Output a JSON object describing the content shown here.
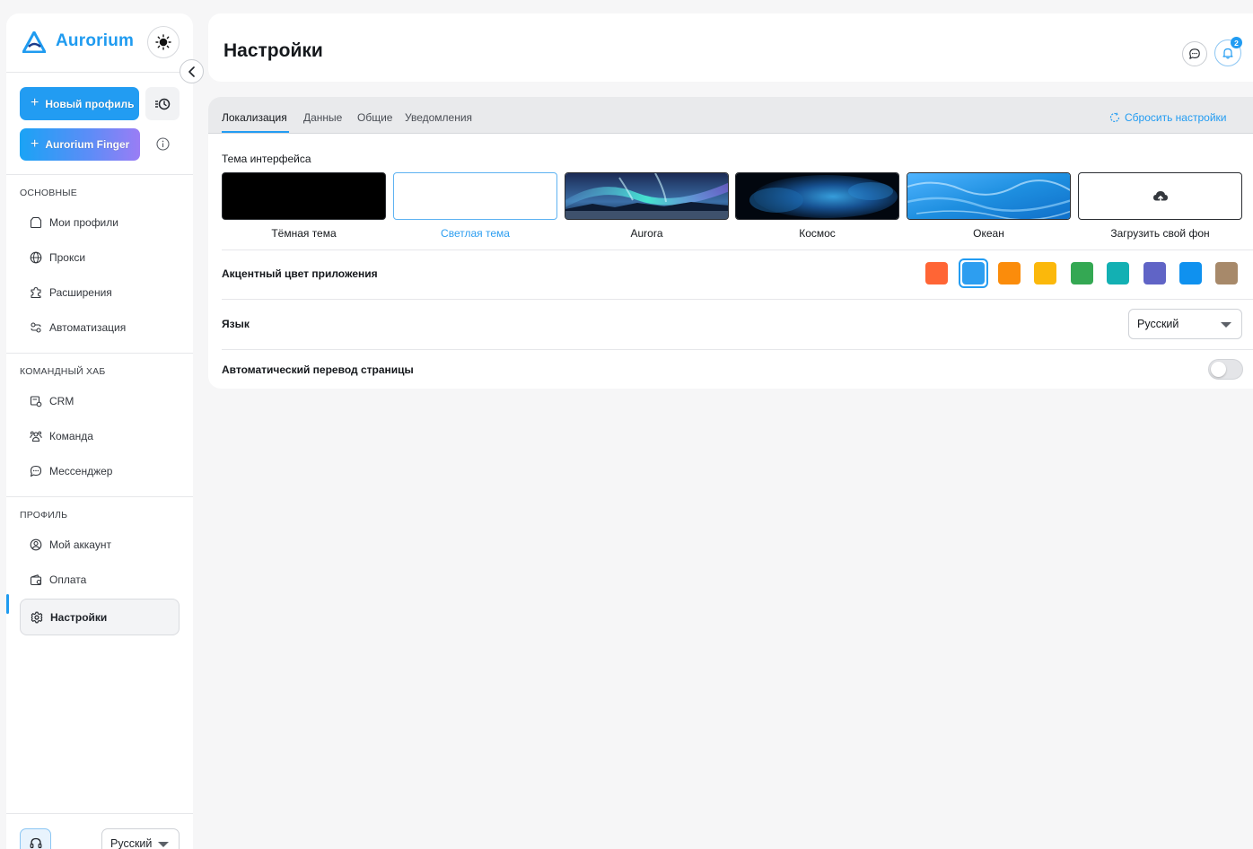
{
  "app": {
    "name": "Aurorium"
  },
  "sidebar": {
    "new_profile_label": "Новый профиль",
    "finger_label": "Aurorium Finger",
    "sections": [
      {
        "title": "ОСНОВНЫЕ",
        "items": [
          {
            "label": "Мои профили",
            "icon": "box-icon"
          },
          {
            "label": "Прокси",
            "icon": "globe-icon"
          },
          {
            "label": "Расширения",
            "icon": "puzzle-icon"
          },
          {
            "label": "Автоматизация",
            "icon": "automation-icon"
          }
        ]
      },
      {
        "title": "КОМАНДНЫЙ ХАБ",
        "items": [
          {
            "label": "CRM",
            "icon": "crm-icon"
          },
          {
            "label": "Команда",
            "icon": "team-icon"
          },
          {
            "label": "Мессенджер",
            "icon": "chat-icon"
          }
        ]
      },
      {
        "title": "ПРОФИЛЬ",
        "items": [
          {
            "label": "Мой аккаунт",
            "icon": "user-circle-icon"
          },
          {
            "label": "Оплата",
            "icon": "wallet-icon"
          },
          {
            "label": "Настройки",
            "icon": "gear-icon",
            "active": true
          }
        ]
      }
    ],
    "language": "Русский"
  },
  "header": {
    "title": "Настройки",
    "notifications_count": "2"
  },
  "settings": {
    "tabs": [
      {
        "label": "Локализация",
        "active": true
      },
      {
        "label": "Данные"
      },
      {
        "label": "Общие"
      },
      {
        "label": "Уведомления"
      }
    ],
    "reset_label": "Сбросить настройки",
    "theme": {
      "label": "Тема интерфейса",
      "options": [
        {
          "name": "Тёмная тема"
        },
        {
          "name": "Светлая тема",
          "selected": true
        },
        {
          "name": "Aurora"
        },
        {
          "name": "Космос"
        },
        {
          "name": "Океан"
        },
        {
          "name": "Загрузить свой фон"
        }
      ]
    },
    "accent": {
      "label": "Акцентный цвет приложения",
      "colors": [
        "#ff6535",
        "#2d9ef0",
        "#fb8c0b",
        "#fbb80b",
        "#34a853",
        "#13b0b3",
        "#6064c6",
        "#0f91ef",
        "#a7896a"
      ],
      "selected_index": 1
    },
    "language": {
      "label": "Язык",
      "value": "Русский"
    },
    "auto_translate": {
      "label": "Автоматический перевод страницы",
      "enabled": false
    }
  }
}
